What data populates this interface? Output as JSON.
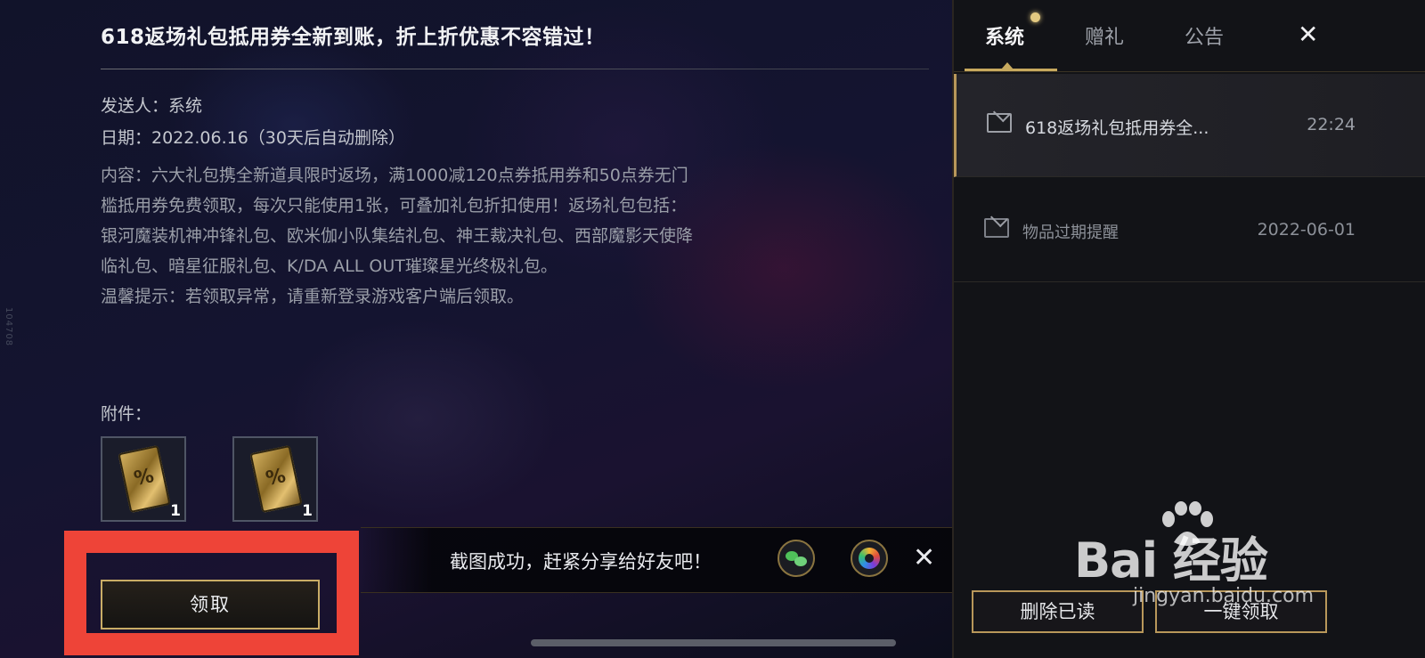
{
  "mail": {
    "title": "618返场礼包抵用券全新到账，折上折优惠不容错过！",
    "sender_line": "发送人：系统",
    "date_line": "日期：2022.06.16（30天后自动删除）",
    "content_lines": [
      "内容：六大礼包携全新道具限时返场，满1000减120点券抵用券和50点券无门",
      "槛抵用券免费领取，每次只能使用1张，可叠加礼包折扣使用！返场礼包包括：",
      "银河魔装机神冲锋礼包、欧米伽小队集结礼包、神王裁决礼包、西部魔影天使降",
      "临礼包、暗星征服礼包、K/DA ALL OUT璀璨星光终极礼包。",
      "温馨提示：若领取异常，请重新登录游戏客户端后领取。"
    ],
    "attachments_label": "附件：",
    "attachments": [
      {
        "icon": "coupon-ticket-icon",
        "qty": "1"
      },
      {
        "icon": "coupon-ticket-icon",
        "qty": "1"
      }
    ],
    "claim_label": "领取"
  },
  "share_bar": {
    "text": "截图成功，赶紧分享给好友吧！",
    "icons": [
      "wechat-icon",
      "moments-icon"
    ],
    "close": "✕"
  },
  "side_text": "104708",
  "panel": {
    "tabs": [
      {
        "label": "系统",
        "active": true
      },
      {
        "label": "赠礼",
        "active": false
      },
      {
        "label": "公告",
        "active": false
      }
    ],
    "close": "✕",
    "mails": [
      {
        "subject": "618返场礼包抵用券全...",
        "time": "22:24",
        "selected": true
      },
      {
        "subject": "物品过期提醒",
        "time": "2022-06-01",
        "selected": false
      }
    ],
    "delete_read_label": "删除已读",
    "claim_all_label": "一键领取"
  },
  "watermark": {
    "main": "Bai  经验",
    "sub": "jingyan.baidu.com"
  },
  "colors": {
    "accent_gold": "#c7a95e",
    "highlight_red": "#ee4438"
  }
}
